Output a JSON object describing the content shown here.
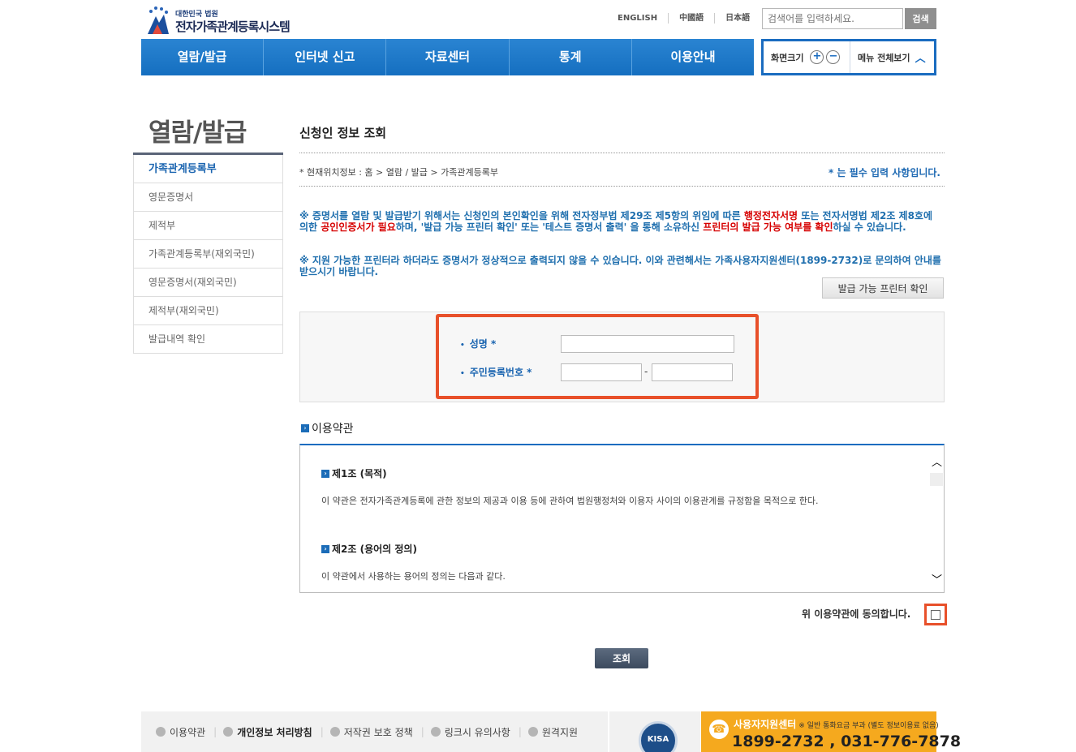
{
  "header": {
    "logo_small": "대한민국 법원",
    "logo_title": "전자가족관계등록시스템",
    "languages": [
      "ENGLISH",
      "中國語",
      "日本語"
    ],
    "search_placeholder": "검색어를 입력하세요.",
    "search_button": "검색",
    "nav": [
      "열람/발급",
      "인터넷 신고",
      "자료센터",
      "통계",
      "이용안내"
    ],
    "zoom_label": "화면크기",
    "menu_all_label": "메뉴 전체보기"
  },
  "sidebar": {
    "title": "열람/발급",
    "items": [
      {
        "label": "가족관계등록부"
      },
      {
        "label": "영문증명서"
      },
      {
        "label": "제적부"
      },
      {
        "label": "가족관계등록부(재외국민)"
      },
      {
        "label": "영문증명서(재외국민)"
      },
      {
        "label": "제적부(재외국민)"
      },
      {
        "label": "발급내역 확인"
      }
    ]
  },
  "main": {
    "title": "신청인 정보 조회",
    "breadcrumb": "* 현재위치정보 : 홈 > 열람 / 발급 > 가족관계등록부",
    "required_note": "* 는 필수 입력 사항입니다.",
    "notice1": {
      "part1": "※ 증명서를 열람 및 발급받기 위해서는 신청인의 본인확인을 위해 전자정부법 제29조 제5항의 위임에 따른 ",
      "red1": "행정전자서명",
      "part2": " 또는 전자서명법 제2조 제8호에 의한 ",
      "red2": "공인인증서가 필요",
      "part3": "하며, '발급 가능 프린터 확인' 또는 '테스트 증명서 출력' 을 통해 소유하신 ",
      "red3": "프린터의 발급 가능 여부를 확인",
      "part4": "하실 수 있습니다."
    },
    "notice2": "※ 지원 가능한 프린터라 하더라도 증명서가 정상적으로 출력되지 않을 수 있습니다. 이와 관련해서는 가족사용자지원센터(1899-2732)로 문의하여 안내를 받으시기 바랍니다.",
    "printer_button": "발급 가능 프린터 확인",
    "form": {
      "name_label": "성명 *",
      "rrn_label": "주민등록번호 *",
      "name_value": "",
      "rrn_front": "",
      "rrn_back": "",
      "dash": "-"
    },
    "terms": {
      "heading": "이용약관",
      "articles": [
        {
          "title": "제1조 (목적)",
          "body": "이 약관은 전자가족관계등록에 관한 정보의 제공과 이용 등에 관하여 법원행정처와 이용자 사이의 이용관계를 규정함을 목적으로 한다."
        },
        {
          "title": "제2조 (용어의 정의)",
          "body": "이 약관에서 사용하는 용어의 정의는 다음과 같다."
        }
      ],
      "agree_label": "위 이용약관에 동의합니다."
    },
    "submit_button": "조회"
  },
  "footer": {
    "links": [
      "이용약관",
      "개인정보 처리방침",
      "저작권 보호 정책",
      "링크시 유의사항",
      "원격지원"
    ],
    "kisa_label": "KISA",
    "support_title": "사용자지원센터",
    "support_note": "※ 일반 통화요금 부과 (별도 정보이용료 없음)",
    "support_phone": "1899-2732 , 031-776-7878"
  },
  "colors": {
    "nav_blue": "#1a6cc0",
    "notice_blue": "#1f6fae",
    "highlight_red": "#e8502a",
    "support_orange": "#f5a91e"
  }
}
